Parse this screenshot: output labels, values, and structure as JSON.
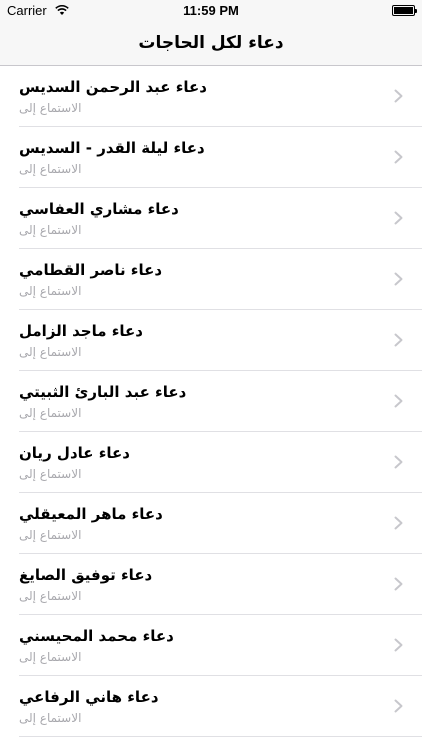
{
  "status_bar": {
    "carrier": "Carrier",
    "time": "11:59 PM"
  },
  "nav": {
    "title": "دعاء لكل الحاجات"
  },
  "items": [
    {
      "title": "دعاء عبد الرحمن السديس",
      "subtitle": "الاستماع إلى"
    },
    {
      "title": "دعاء ليلة القدر - السديس",
      "subtitle": "الاستماع إلى"
    },
    {
      "title": "دعاء مشاري العفاسي",
      "subtitle": "الاستماع إلى"
    },
    {
      "title": "دعاء ناصر القطامي",
      "subtitle": "الاستماع إلى"
    },
    {
      "title": "دعاء ماجد الزامل",
      "subtitle": "الاستماع إلى"
    },
    {
      "title": "دعاء عبد البارئ الثبيتي",
      "subtitle": "الاستماع إلى"
    },
    {
      "title": "دعاء عادل ريان",
      "subtitle": "الاستماع إلى"
    },
    {
      "title": "دعاء ماهر المعيقلي",
      "subtitle": "الاستماع إلى"
    },
    {
      "title": "دعاء توفيق الصايغ",
      "subtitle": "الاستماع إلى"
    },
    {
      "title": "دعاء محمد المحيسني",
      "subtitle": "الاستماع إلى"
    },
    {
      "title": "دعاء هاني الرفاعي",
      "subtitle": "الاستماع إلى"
    }
  ],
  "icons": {
    "row_accessory": "chevron-right-icon",
    "wifi": "wifi-icon",
    "battery": "battery-icon"
  },
  "colors": {
    "bar_background": "#f7f7f7",
    "subtitle": "#a9a9ae",
    "chevron": "#c7c7cc",
    "separator": "#e0e0e4"
  }
}
